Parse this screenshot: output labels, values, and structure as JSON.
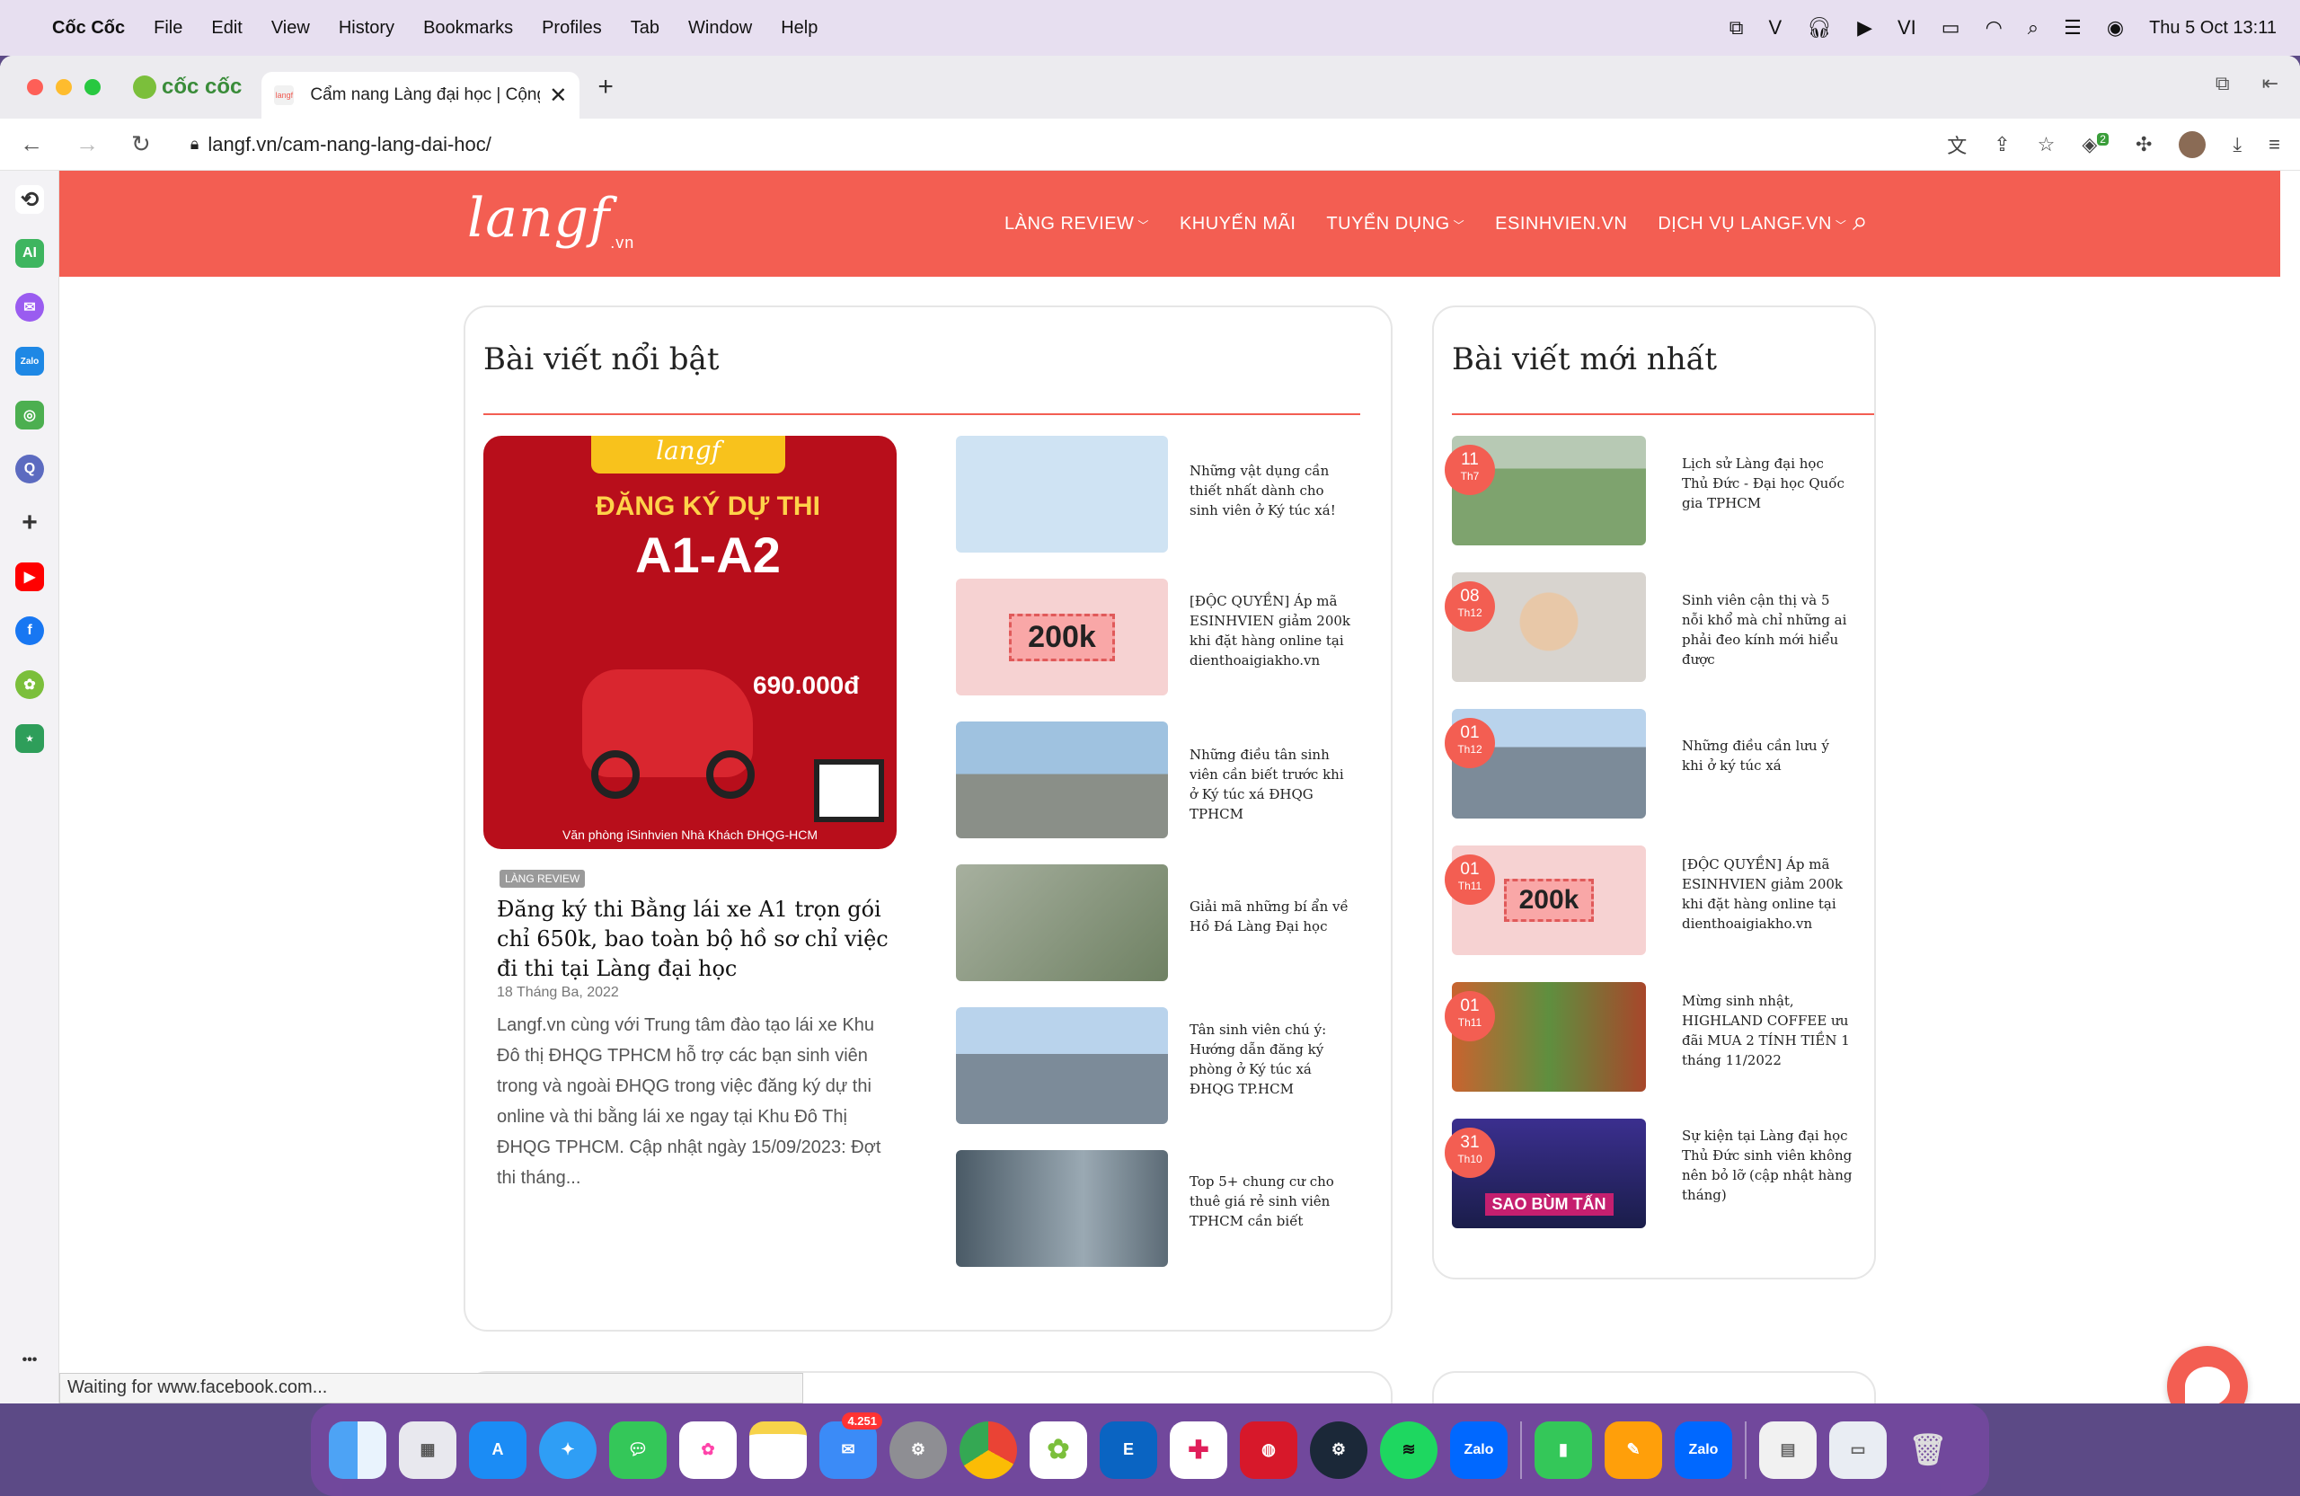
{
  "menubar": {
    "app": "Cốc Cốc",
    "items": [
      "File",
      "Edit",
      "View",
      "History",
      "Bookmarks",
      "Profiles",
      "Tab",
      "Window",
      "Help"
    ],
    "lang": "VI",
    "datetime": "Thu 5 Oct  13:11"
  },
  "browser": {
    "brand": "cốc cốc",
    "tab_title": "Cẩm nang Làng đại học | Cộng",
    "url": "langf.vn/cam-nang-lang-dai-hoc/",
    "ext_badge": "2",
    "status_text": "Waiting for www.facebook.com..."
  },
  "site": {
    "logo": "langf",
    "logo_suffix": ".vn",
    "nav": [
      "LÀNG REVIEW",
      "KHUYẾN MÃI",
      "TUYỂN DỤNG",
      "ESINHVIEN.VN",
      "DỊCH VỤ LANGF.VN"
    ],
    "accent": "#f35e52"
  },
  "featured": {
    "heading": "Bài viết nổi bật",
    "image_text": {
      "logo": "langf",
      "line1": "ĐĂNG KÝ DỰ THI",
      "line2": "A1-A2",
      "price": "690.000đ",
      "bottom": "Văn phòng iSinhvien Nhà Khách ĐHQG-HCM"
    },
    "tag": "LÀNG REVIEW",
    "title": "Đăng ký thi Bằng lái xe A1 trọn gói chỉ 650k, bao toàn bộ hồ sơ chỉ việc đi thi tại Làng đại học",
    "date": "18 Tháng Ba, 2022",
    "excerpt": "Langf.vn cùng với Trung tâm đào tạo lái xe Khu Đô thị ĐHQG TPHCM hỗ trợ các bạn sinh viên trong và ngoài ĐHQG trong việc đăng ký dự thi online và thi bằng lái xe ngay tại Khu Đô Thị ĐHQG TPHCM. Cập nhật ngày 15/09/2023: Đợt thi tháng...",
    "list": [
      {
        "title": "Những vật dụng cần thiết nhất dành cho sinh viên ở Ký túc xá!",
        "color": "#cfe3f3"
      },
      {
        "title": "[ĐỘC QUYỀN] Áp mã ESINHVIEN giảm 200k khi đặt hàng online tại dienthoaigiakho.vn",
        "color": "#f6d2d2",
        "img_text": "200k"
      },
      {
        "title": "Những điều tân sinh viên cần biết trước khi ở Ký túc xá ĐHQG TPHCM",
        "color": "#9fb7c9"
      },
      {
        "title": "Giải mã những bí ẩn về Hồ Đá Làng Đại học",
        "color": "#8e9f86"
      },
      {
        "title": "Tân sinh viên chú ý: Hướng dẫn đăng ký phòng ở Ký túc xá ĐHQG TP.HCM",
        "color": "#8fb0cf"
      },
      {
        "title": "Top 5+ chung cư cho thuê giá rẻ sinh viên TPHCM cần biết",
        "color": "#6d7f8d"
      }
    ]
  },
  "latest": {
    "heading": "Bài viết mới nhất",
    "list": [
      {
        "day": "11",
        "month": "Th7",
        "title": "Lịch sử Làng đại học Thủ Đức - Đại học Quốc gia TPHCM",
        "color": "#7ea36e"
      },
      {
        "day": "08",
        "month": "Th12",
        "title": "Sinh viên cận thị và 5 nỗi khổ mà chỉ những ai phải đeo kính mới hiểu được",
        "color": "#d8c9b6"
      },
      {
        "day": "01",
        "month": "Th12",
        "title": "Những điều cần lưu ý khi ở ký túc xá",
        "color": "#8fb0cf"
      },
      {
        "day": "01",
        "month": "Th11",
        "title": "[ĐỘC QUYỀN] Áp mã ESINHVIEN giảm 200k khi đặt hàng online tại dienthoaigiakho.vn",
        "color": "#f6d2d2",
        "img_text": "200k"
      },
      {
        "day": "01",
        "month": "Th11",
        "title": "Mừng sinh nhật, HIGHLAND COFFEE ưu đãi MUA 2 TÍNH TIỀN 1 tháng 11/2022",
        "color": "#b6512e"
      },
      {
        "day": "31",
        "month": "Th10",
        "title": "Sự kiện tại Làng đại học Thủ Đức sinh viên không nên bỏ lỡ (cập nhật hàng tháng)",
        "color": "#2a2f73",
        "img_text": "SAO BÙM TẤN"
      }
    ]
  },
  "dock": {
    "mail_badge": "4.251",
    "items": [
      "Finder",
      "Launchpad",
      "App Store",
      "Safari",
      "Messages",
      "Photos",
      "Notes",
      "Mail",
      "System Settings",
      "Chrome",
      "Cốc Cốc",
      "Outlook",
      "Slack",
      "Fingerprint",
      "Steam",
      "Spotify",
      "Zalo",
      "Numbers",
      "Pages",
      "Zalo",
      "Docs",
      "Window",
      "Trash"
    ]
  }
}
